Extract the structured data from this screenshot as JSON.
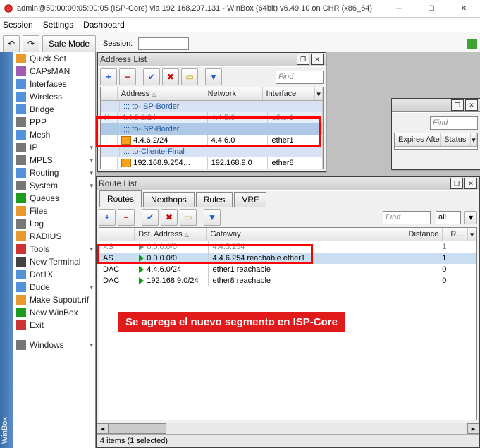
{
  "window": {
    "title": "admin@50:00:00:05:00:05 (ISP-Core) via 192.168.207.131 - WinBox (64bit) v6.49.10 on CHR (x86_64)"
  },
  "menubar": [
    "Session",
    "Settings",
    "Dashboard"
  ],
  "main_toolbar": {
    "safe_mode": "Safe Mode",
    "session_label": "Session:"
  },
  "sidebar_title": "WinBox",
  "sidebar": [
    {
      "label": "Quick Set",
      "icon": "ic-orange",
      "name": "quick-set"
    },
    {
      "label": "CAPsMAN",
      "icon": "ic-purple",
      "name": "capsman"
    },
    {
      "label": "Interfaces",
      "icon": "ic-generic",
      "name": "interfaces"
    },
    {
      "label": "Wireless",
      "icon": "ic-generic",
      "name": "wireless"
    },
    {
      "label": "Bridge",
      "icon": "ic-generic",
      "name": "bridge"
    },
    {
      "label": "PPP",
      "icon": "ic-grey",
      "name": "ppp"
    },
    {
      "label": "Mesh",
      "icon": "ic-generic",
      "name": "mesh"
    },
    {
      "label": "IP",
      "icon": "ic-grey",
      "name": "ip",
      "caret": true
    },
    {
      "label": "MPLS",
      "icon": "ic-grey",
      "name": "mpls",
      "caret": true
    },
    {
      "label": "Routing",
      "icon": "ic-generic",
      "name": "routing",
      "caret": true
    },
    {
      "label": "System",
      "icon": "ic-grey",
      "name": "system",
      "caret": true
    },
    {
      "label": "Queues",
      "icon": "ic-green",
      "name": "queues"
    },
    {
      "label": "Files",
      "icon": "ic-orange",
      "name": "files"
    },
    {
      "label": "Log",
      "icon": "ic-grey",
      "name": "log"
    },
    {
      "label": "RADIUS",
      "icon": "ic-orange",
      "name": "radius"
    },
    {
      "label": "Tools",
      "icon": "ic-red",
      "name": "tools",
      "caret": true
    },
    {
      "label": "New Terminal",
      "icon": "ic-dark",
      "name": "new-terminal"
    },
    {
      "label": "Dot1X",
      "icon": "ic-generic",
      "name": "dot1x"
    },
    {
      "label": "Dude",
      "icon": "ic-generic",
      "name": "dude",
      "caret": true
    },
    {
      "label": "Make Supout.rif",
      "icon": "ic-orange",
      "name": "make-supout"
    },
    {
      "label": "New WinBox",
      "icon": "ic-green",
      "name": "new-winbox"
    },
    {
      "label": "Exit",
      "icon": "ic-red",
      "name": "exit"
    }
  ],
  "sidebar_extra": {
    "label": "Windows",
    "icon": "ic-grey",
    "name": "windows",
    "caret": true
  },
  "address_list": {
    "title": "Address List",
    "find": "Find",
    "columns": [
      "Address",
      "Network",
      "Interface"
    ],
    "widths": [
      140,
      90,
      80
    ],
    "rows": [
      {
        "type": "group",
        "text": "::; to-ISP-Border"
      },
      {
        "type": "x",
        "cells": [
          "4.4.5.2/24",
          "4.4.5.0",
          "ether1"
        ],
        "flag": "X"
      },
      {
        "type": "group-highlight",
        "text": ";;; to-ISP-Border"
      },
      {
        "type": "data-highlight",
        "cells": [
          "4.4.6.2/24",
          "4.4.6.0",
          "ether1"
        ],
        "icon": "yellow"
      },
      {
        "type": "group",
        "text": "::: to-Cliente-Final"
      },
      {
        "type": "data",
        "cells": [
          "192.168.9.254…",
          "192.168.9.0",
          "ether8"
        ],
        "icon": "yellow"
      }
    ]
  },
  "small_win": {
    "find": "Find",
    "columns": [
      "Expires After",
      "Status"
    ]
  },
  "route_list": {
    "title": "Route List",
    "tabs": [
      "Routes",
      "Nexthops",
      "Rules",
      "VRF"
    ],
    "active_tab": 0,
    "find": "Find",
    "all": "all",
    "columns": [
      "",
      "Dst. Address",
      "Gateway",
      "Distance",
      "R…"
    ],
    "widths": [
      44,
      102,
      296,
      55,
      28
    ],
    "rows": [
      {
        "flag": "XS",
        "tri": "grey",
        "dst": "0.0.0.0/0",
        "gw": "4.4.5.254",
        "dist": "1",
        "r": "",
        "cls": "grey"
      },
      {
        "flag": "AS",
        "tri": "green",
        "dst": "0.0.0.0/0",
        "gw": "4.4.6.254 reachable ether1",
        "dist": "1",
        "r": "",
        "cls": "sel"
      },
      {
        "flag": "DAC",
        "tri": "green",
        "dst": "4.4.6.0/24",
        "gw": "ether1 reachable",
        "dist": "0",
        "r": "",
        "cls": ""
      },
      {
        "flag": "DAC",
        "tri": "green",
        "dst": "192.168.9.0/24",
        "gw": "ether8 reachable",
        "dist": "0",
        "r": "",
        "cls": ""
      }
    ],
    "status": "4 items (1 selected)"
  },
  "annotation": "Se agrega el nuevo segmento en ISP-Core"
}
